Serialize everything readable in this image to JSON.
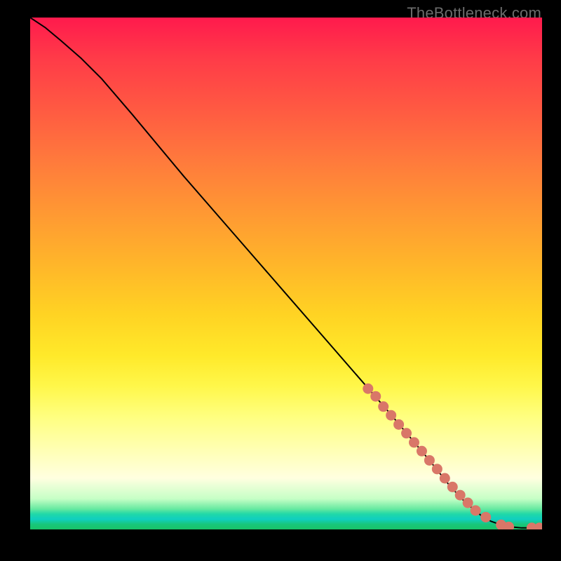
{
  "watermark": "TheBottleneck.com",
  "colors": {
    "curve": "#000000",
    "marker_fill": "#d97768",
    "marker_stroke": "#d97768"
  },
  "chart_data": {
    "type": "line",
    "title": "",
    "xlabel": "",
    "ylabel": "",
    "xlim": [
      0,
      100
    ],
    "ylim": [
      0,
      100
    ],
    "grid": false,
    "legend": false,
    "series": [
      {
        "name": "curve",
        "style": "line",
        "x": [
          0,
          3,
          6,
          10,
          14,
          20,
          30,
          40,
          50,
          60,
          70,
          78,
          82,
          85,
          88,
          90,
          92,
          94,
          96,
          98,
          100
        ],
        "values": [
          100,
          98,
          95.5,
          92,
          88,
          81,
          69,
          57.5,
          46,
          34.5,
          23,
          13.5,
          8.5,
          5.3,
          2.8,
          1.6,
          0.9,
          0.5,
          0.3,
          0.3,
          0.3
        ]
      },
      {
        "name": "markers",
        "style": "scatter",
        "x": [
          66,
          67.5,
          69,
          70.5,
          72,
          73.5,
          75,
          76.5,
          78,
          79.5,
          81,
          82.5,
          84,
          85.5,
          87,
          89,
          92,
          93.5,
          98,
          99.5
        ],
        "values": [
          27.5,
          26,
          24,
          22.3,
          20.5,
          18.8,
          17,
          15.3,
          13.5,
          11.8,
          10,
          8.3,
          6.7,
          5.2,
          3.7,
          2.4,
          0.9,
          0.5,
          0.3,
          0.3
        ]
      }
    ]
  }
}
